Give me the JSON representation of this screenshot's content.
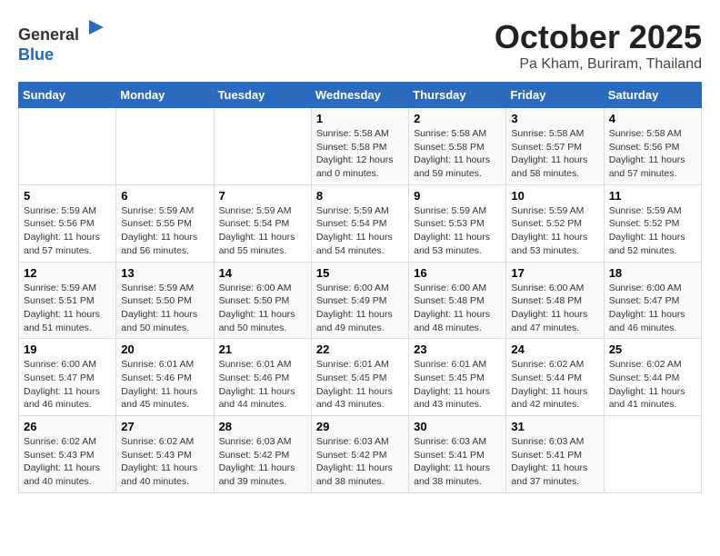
{
  "header": {
    "logo_general": "General",
    "logo_blue": "Blue",
    "month_year": "October 2025",
    "location": "Pa Kham, Buriram, Thailand"
  },
  "calendar": {
    "weekdays": [
      "Sunday",
      "Monday",
      "Tuesday",
      "Wednesday",
      "Thursday",
      "Friday",
      "Saturday"
    ],
    "weeks": [
      [
        {
          "day": "",
          "info": ""
        },
        {
          "day": "",
          "info": ""
        },
        {
          "day": "",
          "info": ""
        },
        {
          "day": "1",
          "info": "Sunrise: 5:58 AM\nSunset: 5:58 PM\nDaylight: 12 hours\nand 0 minutes."
        },
        {
          "day": "2",
          "info": "Sunrise: 5:58 AM\nSunset: 5:58 PM\nDaylight: 11 hours\nand 59 minutes."
        },
        {
          "day": "3",
          "info": "Sunrise: 5:58 AM\nSunset: 5:57 PM\nDaylight: 11 hours\nand 58 minutes."
        },
        {
          "day": "4",
          "info": "Sunrise: 5:58 AM\nSunset: 5:56 PM\nDaylight: 11 hours\nand 57 minutes."
        }
      ],
      [
        {
          "day": "5",
          "info": "Sunrise: 5:59 AM\nSunset: 5:56 PM\nDaylight: 11 hours\nand 57 minutes."
        },
        {
          "day": "6",
          "info": "Sunrise: 5:59 AM\nSunset: 5:55 PM\nDaylight: 11 hours\nand 56 minutes."
        },
        {
          "day": "7",
          "info": "Sunrise: 5:59 AM\nSunset: 5:54 PM\nDaylight: 11 hours\nand 55 minutes."
        },
        {
          "day": "8",
          "info": "Sunrise: 5:59 AM\nSunset: 5:54 PM\nDaylight: 11 hours\nand 54 minutes."
        },
        {
          "day": "9",
          "info": "Sunrise: 5:59 AM\nSunset: 5:53 PM\nDaylight: 11 hours\nand 53 minutes."
        },
        {
          "day": "10",
          "info": "Sunrise: 5:59 AM\nSunset: 5:52 PM\nDaylight: 11 hours\nand 53 minutes."
        },
        {
          "day": "11",
          "info": "Sunrise: 5:59 AM\nSunset: 5:52 PM\nDaylight: 11 hours\nand 52 minutes."
        }
      ],
      [
        {
          "day": "12",
          "info": "Sunrise: 5:59 AM\nSunset: 5:51 PM\nDaylight: 11 hours\nand 51 minutes."
        },
        {
          "day": "13",
          "info": "Sunrise: 5:59 AM\nSunset: 5:50 PM\nDaylight: 11 hours\nand 50 minutes."
        },
        {
          "day": "14",
          "info": "Sunrise: 6:00 AM\nSunset: 5:50 PM\nDaylight: 11 hours\nand 50 minutes."
        },
        {
          "day": "15",
          "info": "Sunrise: 6:00 AM\nSunset: 5:49 PM\nDaylight: 11 hours\nand 49 minutes."
        },
        {
          "day": "16",
          "info": "Sunrise: 6:00 AM\nSunset: 5:48 PM\nDaylight: 11 hours\nand 48 minutes."
        },
        {
          "day": "17",
          "info": "Sunrise: 6:00 AM\nSunset: 5:48 PM\nDaylight: 11 hours\nand 47 minutes."
        },
        {
          "day": "18",
          "info": "Sunrise: 6:00 AM\nSunset: 5:47 PM\nDaylight: 11 hours\nand 46 minutes."
        }
      ],
      [
        {
          "day": "19",
          "info": "Sunrise: 6:00 AM\nSunset: 5:47 PM\nDaylight: 11 hours\nand 46 minutes."
        },
        {
          "day": "20",
          "info": "Sunrise: 6:01 AM\nSunset: 5:46 PM\nDaylight: 11 hours\nand 45 minutes."
        },
        {
          "day": "21",
          "info": "Sunrise: 6:01 AM\nSunset: 5:46 PM\nDaylight: 11 hours\nand 44 minutes."
        },
        {
          "day": "22",
          "info": "Sunrise: 6:01 AM\nSunset: 5:45 PM\nDaylight: 11 hours\nand 43 minutes."
        },
        {
          "day": "23",
          "info": "Sunrise: 6:01 AM\nSunset: 5:45 PM\nDaylight: 11 hours\nand 43 minutes."
        },
        {
          "day": "24",
          "info": "Sunrise: 6:02 AM\nSunset: 5:44 PM\nDaylight: 11 hours\nand 42 minutes."
        },
        {
          "day": "25",
          "info": "Sunrise: 6:02 AM\nSunset: 5:44 PM\nDaylight: 11 hours\nand 41 minutes."
        }
      ],
      [
        {
          "day": "26",
          "info": "Sunrise: 6:02 AM\nSunset: 5:43 PM\nDaylight: 11 hours\nand 40 minutes."
        },
        {
          "day": "27",
          "info": "Sunrise: 6:02 AM\nSunset: 5:43 PM\nDaylight: 11 hours\nand 40 minutes."
        },
        {
          "day": "28",
          "info": "Sunrise: 6:03 AM\nSunset: 5:42 PM\nDaylight: 11 hours\nand 39 minutes."
        },
        {
          "day": "29",
          "info": "Sunrise: 6:03 AM\nSunset: 5:42 PM\nDaylight: 11 hours\nand 38 minutes."
        },
        {
          "day": "30",
          "info": "Sunrise: 6:03 AM\nSunset: 5:41 PM\nDaylight: 11 hours\nand 38 minutes."
        },
        {
          "day": "31",
          "info": "Sunrise: 6:03 AM\nSunset: 5:41 PM\nDaylight: 11 hours\nand 37 minutes."
        },
        {
          "day": "",
          "info": ""
        }
      ]
    ]
  }
}
